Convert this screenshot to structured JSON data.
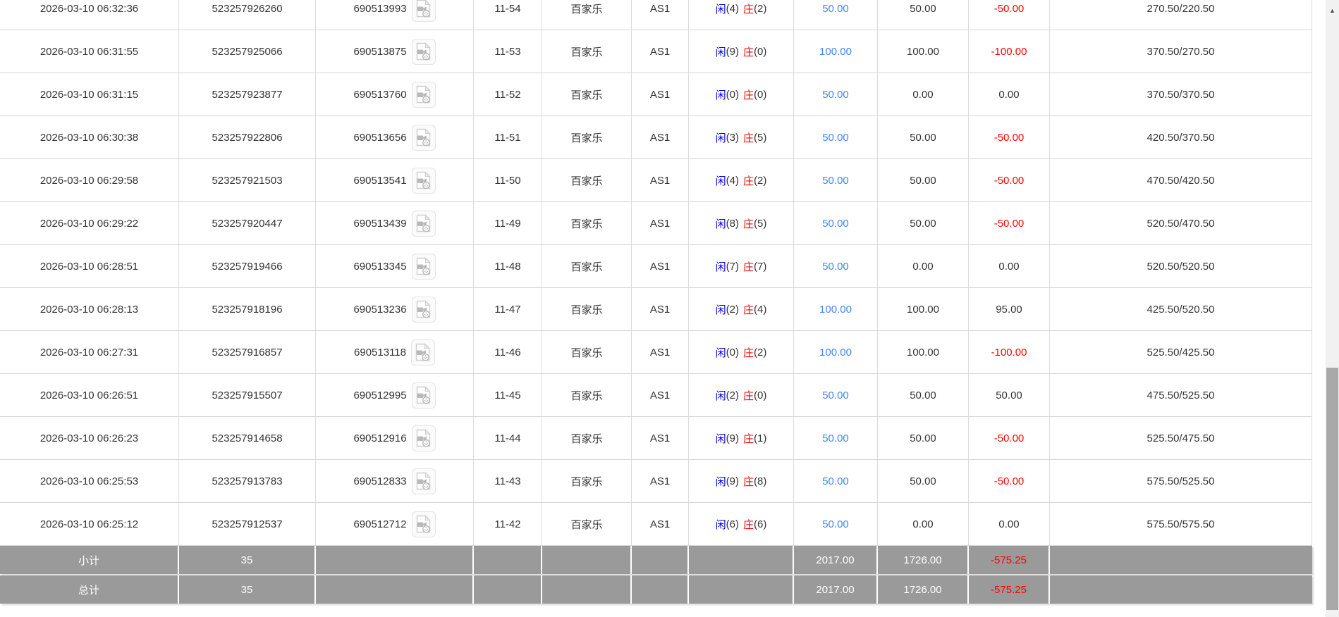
{
  "table": {
    "column_names": [
      "bet_time",
      "order_no",
      "game_no",
      "round",
      "game",
      "table_id",
      "result",
      "bet_amount",
      "valid_amount",
      "win_loss",
      "balance"
    ],
    "rows": [
      {
        "time": "2026-03-10 06:32:36",
        "order_no": "523257926260",
        "game_no": "690513993",
        "round": "11-54",
        "game": "百家乐",
        "table_id": "AS1",
        "player_label": "闲",
        "player_count": "(4)",
        "banker_label": "庄",
        "banker_count": "(2)",
        "bet": "50.00",
        "valid": "50.00",
        "win_loss": "-50.00",
        "balance": "270.50/220.50"
      },
      {
        "time": "2026-03-10 06:31:55",
        "order_no": "523257925066",
        "game_no": "690513875",
        "round": "11-53",
        "game": "百家乐",
        "table_id": "AS1",
        "player_label": "闲",
        "player_count": "(9)",
        "banker_label": "庄",
        "banker_count": "(0)",
        "bet": "100.00",
        "valid": "100.00",
        "win_loss": "-100.00",
        "balance": "370.50/270.50"
      },
      {
        "time": "2026-03-10 06:31:15",
        "order_no": "523257923877",
        "game_no": "690513760",
        "round": "11-52",
        "game": "百家乐",
        "table_id": "AS1",
        "player_label": "闲",
        "player_count": "(0)",
        "banker_label": "庄",
        "banker_count": "(0)",
        "bet": "50.00",
        "valid": "0.00",
        "win_loss": "0.00",
        "balance": "370.50/370.50"
      },
      {
        "time": "2026-03-10 06:30:38",
        "order_no": "523257922806",
        "game_no": "690513656",
        "round": "11-51",
        "game": "百家乐",
        "table_id": "AS1",
        "player_label": "闲",
        "player_count": "(3)",
        "banker_label": "庄",
        "banker_count": "(5)",
        "bet": "50.00",
        "valid": "50.00",
        "win_loss": "-50.00",
        "balance": "420.50/370.50"
      },
      {
        "time": "2026-03-10 06:29:58",
        "order_no": "523257921503",
        "game_no": "690513541",
        "round": "11-50",
        "game": "百家乐",
        "table_id": "AS1",
        "player_label": "闲",
        "player_count": "(4)",
        "banker_label": "庄",
        "banker_count": "(2)",
        "bet": "50.00",
        "valid": "50.00",
        "win_loss": "-50.00",
        "balance": "470.50/420.50"
      },
      {
        "time": "2026-03-10 06:29:22",
        "order_no": "523257920447",
        "game_no": "690513439",
        "round": "11-49",
        "game": "百家乐",
        "table_id": "AS1",
        "player_label": "闲",
        "player_count": "(8)",
        "banker_label": "庄",
        "banker_count": "(5)",
        "bet": "50.00",
        "valid": "50.00",
        "win_loss": "-50.00",
        "balance": "520.50/470.50"
      },
      {
        "time": "2026-03-10 06:28:51",
        "order_no": "523257919466",
        "game_no": "690513345",
        "round": "11-48",
        "game": "百家乐",
        "table_id": "AS1",
        "player_label": "闲",
        "player_count": "(7)",
        "banker_label": "庄",
        "banker_count": "(7)",
        "bet": "50.00",
        "valid": "0.00",
        "win_loss": "0.00",
        "balance": "520.50/520.50"
      },
      {
        "time": "2026-03-10 06:28:13",
        "order_no": "523257918196",
        "game_no": "690513236",
        "round": "11-47",
        "game": "百家乐",
        "table_id": "AS1",
        "player_label": "闲",
        "player_count": "(2)",
        "banker_label": "庄",
        "banker_count": "(4)",
        "bet": "100.00",
        "valid": "100.00",
        "win_loss": "95.00",
        "balance": "425.50/520.50"
      },
      {
        "time": "2026-03-10 06:27:31",
        "order_no": "523257916857",
        "game_no": "690513118",
        "round": "11-46",
        "game": "百家乐",
        "table_id": "AS1",
        "player_label": "闲",
        "player_count": "(0)",
        "banker_label": "庄",
        "banker_count": "(2)",
        "bet": "100.00",
        "valid": "100.00",
        "win_loss": "-100.00",
        "balance": "525.50/425.50"
      },
      {
        "time": "2026-03-10 06:26:51",
        "order_no": "523257915507",
        "game_no": "690512995",
        "round": "11-45",
        "game": "百家乐",
        "table_id": "AS1",
        "player_label": "闲",
        "player_count": "(2)",
        "banker_label": "庄",
        "banker_count": "(0)",
        "bet": "50.00",
        "valid": "50.00",
        "win_loss": "50.00",
        "balance": "475.50/525.50"
      },
      {
        "time": "2026-03-10 06:26:23",
        "order_no": "523257914658",
        "game_no": "690512916",
        "round": "11-44",
        "game": "百家乐",
        "table_id": "AS1",
        "player_label": "闲",
        "player_count": "(9)",
        "banker_label": "庄",
        "banker_count": "(1)",
        "bet": "50.00",
        "valid": "50.00",
        "win_loss": "-50.00",
        "balance": "525.50/475.50"
      },
      {
        "time": "2026-03-10 06:25:53",
        "order_no": "523257913783",
        "game_no": "690512833",
        "round": "11-43",
        "game": "百家乐",
        "table_id": "AS1",
        "player_label": "闲",
        "player_count": "(9)",
        "banker_label": "庄",
        "banker_count": "(8)",
        "bet": "50.00",
        "valid": "50.00",
        "win_loss": "-50.00",
        "balance": "575.50/525.50"
      },
      {
        "time": "2026-03-10 06:25:12",
        "order_no": "523257912537",
        "game_no": "690512712",
        "round": "11-42",
        "game": "百家乐",
        "table_id": "AS1",
        "player_label": "闲",
        "player_count": "(6)",
        "banker_label": "庄",
        "banker_count": "(6)",
        "bet": "50.00",
        "valid": "0.00",
        "win_loss": "0.00",
        "balance": "575.50/575.50"
      }
    ],
    "subtotal": {
      "label": "小计",
      "count": "35",
      "bet": "2017.00",
      "valid": "1726.00",
      "win_loss": "-575.25"
    },
    "total": {
      "label": "总计",
      "count": "35",
      "bet": "2017.00",
      "valid": "1726.00",
      "win_loss": "-575.25"
    }
  },
  "icons": {
    "video_replay": "video-replay-icon",
    "scroll_up_arrow": "▲"
  },
  "colors": {
    "player_blue": "#0000ee",
    "banker_red": "#f00000",
    "bet_link_blue": "#4285f4",
    "loss_red": "#ff0000",
    "summary_gray": "#9a9a9a",
    "grid_line": "#d4d4d4",
    "scroll_track": "#f1f1f1",
    "scroll_thumb": "#a9a9a9"
  }
}
